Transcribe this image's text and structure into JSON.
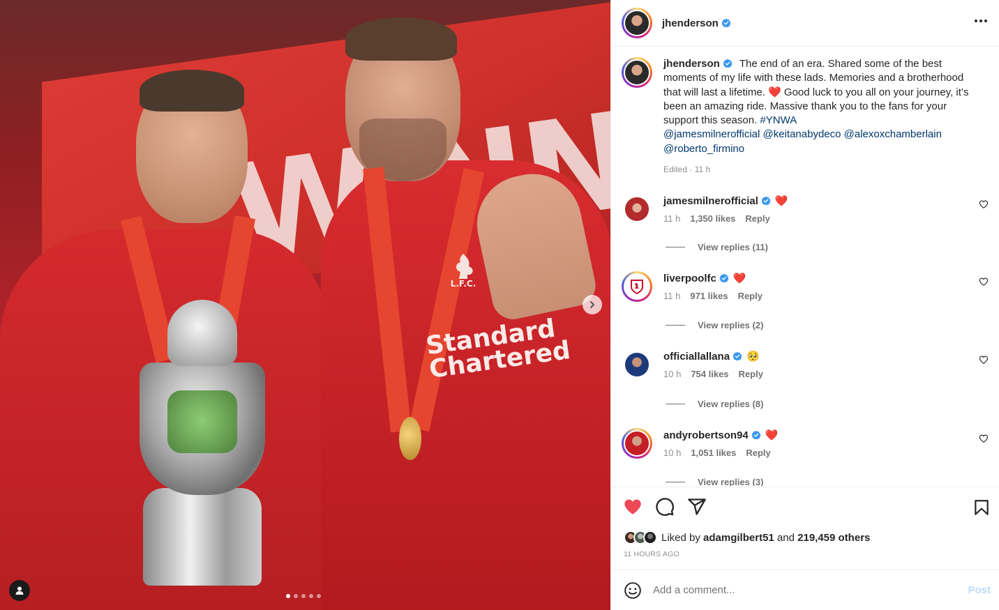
{
  "post": {
    "author": "jhenderson",
    "caption_text": "The end of an era. Shared some of the best moments of my life with these lads. Memories and a brotherhood that will last a lifetime. ❤️ Good luck to you all on your journey, it’s been an amazing ride. Massive thank you to the fans for your support this season.",
    "hashtag": "#YNWA",
    "mentions": [
      "@jamesmilnerofficial",
      "@keitanabydeco",
      "@alexoxchamberlain",
      "@roberto_firmino"
    ],
    "meta": "Edited · 11 h",
    "image": {
      "banner_text": "WINNE",
      "sponsor_text": "Standard Chartered",
      "badge_text": "L.F.C.",
      "carousel_count": 5,
      "carousel_active": 1
    }
  },
  "comments": [
    {
      "user": "jamesmilnerofficial",
      "emoji": "❤️",
      "time": "11 h",
      "likes": "1,350 likes",
      "reply": "Reply",
      "view_replies": "View replies (11)"
    },
    {
      "user": "liverpoolfc",
      "emoji": "❤️",
      "time": "11 h",
      "likes": "971 likes",
      "reply": "Reply",
      "view_replies": "View replies (2)"
    },
    {
      "user": "officiallallana",
      "emoji": "🥺",
      "time": "10 h",
      "likes": "754 likes",
      "reply": "Reply",
      "view_replies": "View replies (8)"
    },
    {
      "user": "andyrobertson94",
      "emoji": "❤️",
      "time": "10 h",
      "likes": "1,051 likes",
      "reply": "Reply",
      "view_replies": "View replies (3)"
    }
  ],
  "likes": {
    "prefix": "Liked by",
    "first_user": "adamgilbert51",
    "and": "and",
    "others": "219,459 others"
  },
  "timestamp": "11 HOURS AGO",
  "comment_box": {
    "placeholder": "Add a comment...",
    "post_label": "Post"
  },
  "colors": {
    "verified": "#3897f0",
    "like_red": "#ed4956",
    "link": "#00376b",
    "post_disabled": "#b8dcfb"
  },
  "icons": [
    "verified-badge-icon",
    "more-options-icon",
    "heart-icon",
    "comment-icon",
    "share-icon",
    "save-icon",
    "emoji-icon",
    "next-arrow-icon",
    "user-tag-icon"
  ]
}
